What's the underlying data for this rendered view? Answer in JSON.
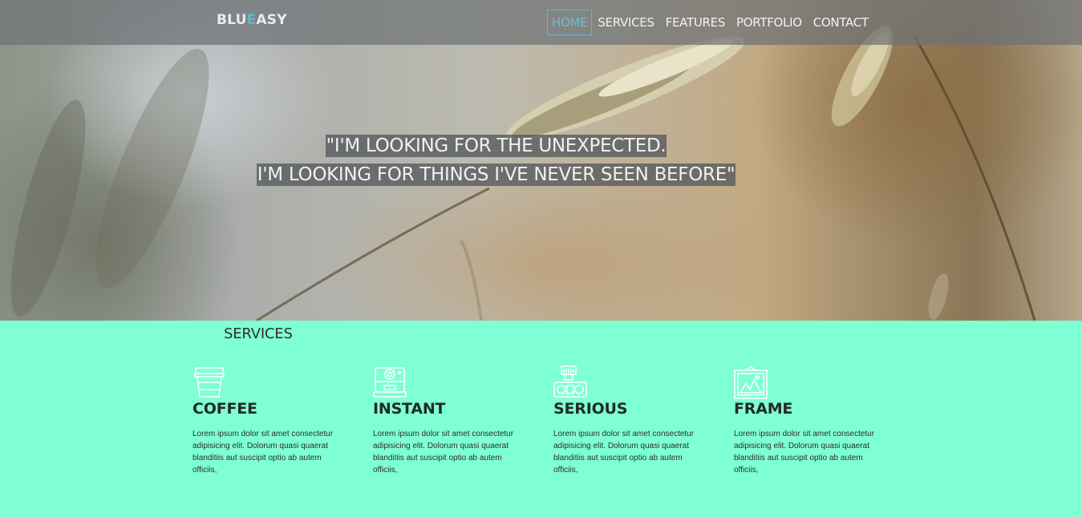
{
  "nav": {
    "brand_prefix": "BLU",
    "brand_accent": "E",
    "brand_suffix": "ASY",
    "items": [
      {
        "label": "HOME",
        "active": true
      },
      {
        "label": "SERVICES",
        "active": false
      },
      {
        "label": "FEATURES",
        "active": false
      },
      {
        "label": "PORTFOLIO",
        "active": false
      },
      {
        "label": "CONTACT",
        "active": false
      }
    ]
  },
  "hero": {
    "quote_line1": "\"I'M LOOKING FOR THE UNEXPECTED.",
    "quote_line2": "I'M LOOKING FOR THINGS I'VE NEVER SEEN BEFORE\""
  },
  "services": {
    "title": "SERVICES",
    "cards": [
      {
        "icon": "coffee-cup-icon",
        "title": "COFFEE",
        "text": "Lorem ipsum dolor sit amet consectetur adipisicing elit. Dolorum quasi quaerat blanditiis aut suscipit optio ab autem officiis,"
      },
      {
        "icon": "instant-camera-icon",
        "title": "INSTANT",
        "text": "Lorem ipsum dolor sit amet consectetur adipisicing elit. Dolorum quasi quaerat blanditiis aut suscipit optio ab autem officiis,"
      },
      {
        "icon": "camera-rig-icon",
        "title": "SERIOUS",
        "text": "Lorem ipsum dolor sit amet consectetur adipisicing elit. Dolorum quasi quaerat blanditiis aut suscipit optio ab autem officiis,"
      },
      {
        "icon": "picture-frame-icon",
        "title": "FRAME",
        "text": "Lorem ipsum dolor sit amet consectetur adipisicing elit. Dolorum quasi quaerat blanditiis aut suscipit optio ab autem officiis,"
      }
    ]
  },
  "colors": {
    "accent": "#5fb7d0",
    "services_bg": "#7fffd4",
    "nav_bg": "#6e7276"
  }
}
